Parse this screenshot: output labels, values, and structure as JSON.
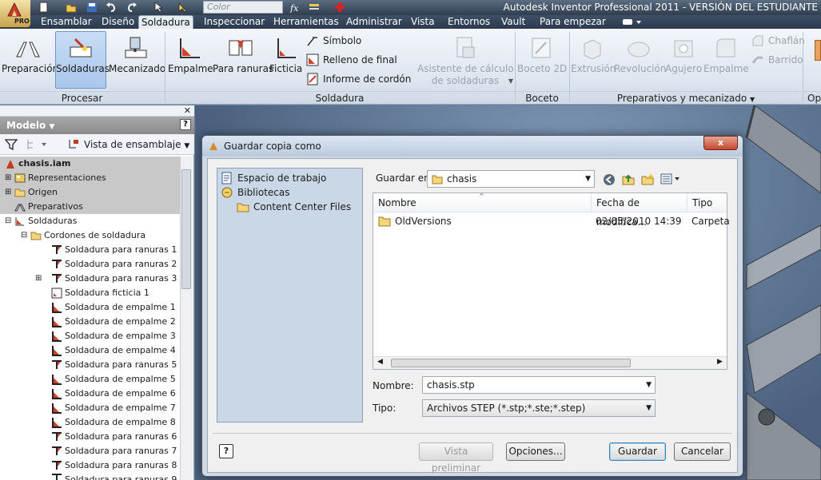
{
  "app": {
    "title": "Autodesk Inventor Professional 2011 - VERSIÓN DEL ESTUDIANTE",
    "pro_badge": "PRO",
    "color_placeholder": "Color"
  },
  "tabs": [
    {
      "label": "Ensamblar"
    },
    {
      "label": "Diseño"
    },
    {
      "label": "Soldadura"
    },
    {
      "label": "Inspeccionar"
    },
    {
      "label": "Herramientas"
    },
    {
      "label": "Administrar"
    },
    {
      "label": "Vista"
    },
    {
      "label": "Entornos"
    },
    {
      "label": "Vault"
    },
    {
      "label": "Para empezar"
    }
  ],
  "ribbon": {
    "procesar": {
      "group_label": "Procesar",
      "preparacion": "Preparación",
      "soldaduras": "Soldaduras",
      "mecanizado": "Mecanizado"
    },
    "soldadura": {
      "group_label": "Soldadura",
      "empalme": "Empalme",
      "para_ranuras": "Para ranuras",
      "ficticia": "Ficticia",
      "simbolo": "Símbolo",
      "relleno": "Relleno de final",
      "informe": "Informe de cordón",
      "asistente_line1": "Asistente de cálculo",
      "asistente_line2": "de soldaduras"
    },
    "boceto": {
      "group_label": "Boceto",
      "boceto2d": "Boceto 2D"
    },
    "preparativos": {
      "group_label": "Preparativos y mecanizado",
      "extrusion": "Extrusión",
      "revolucion": "Revolución",
      "agujero": "Agujero",
      "empalme": "Empalme",
      "chaflan": "Chaflán",
      "barrido": "Barrido"
    },
    "cut_group_label": "Op"
  },
  "browser": {
    "title": "Modelo",
    "help": "?",
    "view_label": "Vista de ensamblaje",
    "tree": [
      {
        "label": "chasis.iam"
      },
      {
        "label": "Representaciones"
      },
      {
        "label": "Origen"
      },
      {
        "label": "Preparativos"
      },
      {
        "label": "Soldaduras"
      },
      {
        "label": "Cordones de soldadura"
      },
      {
        "label": "Soldadura para ranuras 1"
      },
      {
        "label": "Soldadura para ranuras 2"
      },
      {
        "label": "Soldadura para ranuras 3"
      },
      {
        "label": "Soldadura ficticia 1"
      },
      {
        "label": "Soldadura de empalme 1"
      },
      {
        "label": "Soldadura de empalme 2"
      },
      {
        "label": "Soldadura de empalme 3"
      },
      {
        "label": "Soldadura de empalme 4"
      },
      {
        "label": "Soldadura para ranuras 5"
      },
      {
        "label": "Soldadura de empalme 5"
      },
      {
        "label": "Soldadura de empalme 6"
      },
      {
        "label": "Soldadura de empalme 7"
      },
      {
        "label": "Soldadura de empalme 8"
      },
      {
        "label": "Soldadura para ranuras 6"
      },
      {
        "label": "Soldadura para ranuras 7"
      },
      {
        "label": "Soldadura para ranuras 8"
      },
      {
        "label": "Soldadura para ranuras 9"
      }
    ]
  },
  "dialog": {
    "title": "Guardar copia como",
    "close": "x",
    "places": {
      "workspace": "Espacio de trabajo",
      "libraries": "Bibliotecas",
      "content_center": "Content Center Files"
    },
    "save_in_label": "Guardar en:",
    "save_in_value": "chasis",
    "columns": {
      "name": "Nombre",
      "date": "Fecha de modifica...",
      "type": "Tipo"
    },
    "files": [
      {
        "name": "OldVersions",
        "date": "02/05/2010 14:39",
        "type": "Carpeta"
      }
    ],
    "filename_label": "Nombre:",
    "filename_value": "chasis.stp",
    "filetype_label": "Tipo:",
    "filetype_value": "Archivos STEP (*.stp;*.ste;*.step)",
    "help": "?",
    "buttons": {
      "preview": "Vista preliminar",
      "options": "Opciones...",
      "save": "Guardar",
      "cancel": "Cancelar"
    }
  }
}
